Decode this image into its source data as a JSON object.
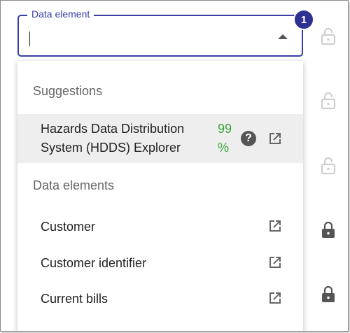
{
  "field": {
    "label": "Data element",
    "value": ""
  },
  "step_badge": "1",
  "dropdown": {
    "suggestions_title": "Suggestions",
    "suggestion": {
      "name_line1": "Hazards Data Distribution",
      "name_line2": "System (HDDS) Explorer",
      "match_line1": "99",
      "match_line2": "%",
      "match_color": "#3aa33a"
    },
    "data_elements_title": "Data elements",
    "items": [
      {
        "label": "Customer"
      },
      {
        "label": "Customer identifier"
      },
      {
        "label": "Current bills"
      }
    ]
  },
  "locks": [
    {
      "state": "unlocked",
      "icon": "lock-open-icon"
    },
    {
      "state": "unlocked",
      "icon": "lock-open-icon"
    },
    {
      "state": "unlocked",
      "icon": "lock-open-icon"
    },
    {
      "state": "locked",
      "icon": "lock-closed-icon"
    },
    {
      "state": "locked",
      "icon": "lock-closed-icon"
    }
  ],
  "colors": {
    "accent": "#3a3ea6",
    "badge": "#2e3191",
    "suggestion_bg": "#eeeeee"
  }
}
